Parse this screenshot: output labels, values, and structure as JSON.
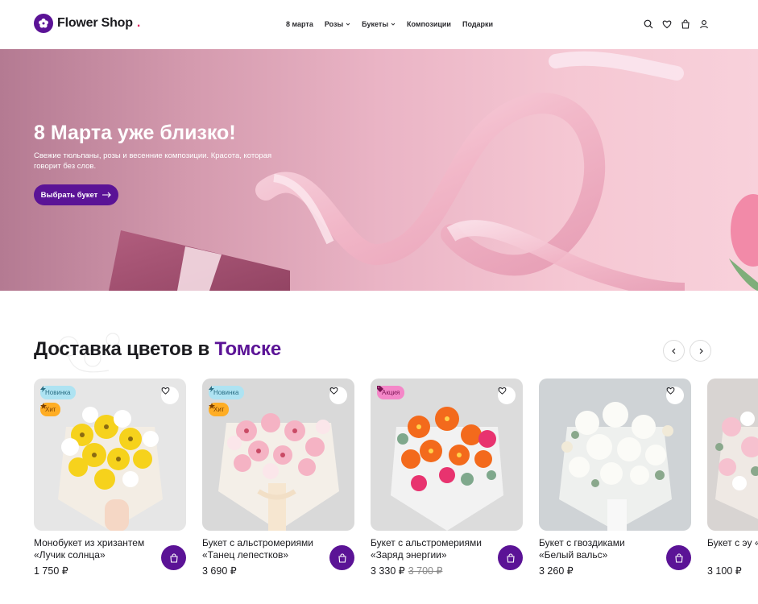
{
  "header": {
    "logo_text": "Flower Shop",
    "logo_dot": ".",
    "nav": [
      {
        "label": "8 марта",
        "dropdown": false
      },
      {
        "label": "Розы",
        "dropdown": true
      },
      {
        "label": "Букеты",
        "dropdown": true
      },
      {
        "label": "Композиции",
        "dropdown": false
      },
      {
        "label": "Подарки",
        "dropdown": false
      }
    ],
    "icons": [
      "search-icon",
      "heart-icon",
      "cart-icon",
      "user-icon"
    ]
  },
  "hero": {
    "title": "8 Марта уже близко!",
    "text": "Свежие тюльпаны, розы и весенние композиции. Красота, которая говорит без слов.",
    "button_label": "Выбрать букет",
    "button_icon": "arrow-right-icon"
  },
  "section": {
    "title_prefix": "Доставка цветов в ",
    "title_city": "Томске"
  },
  "products": [
    {
      "name": "Монобукет из хризантем «Лучик солнца»",
      "price": "1 750 ₽",
      "old_price": "",
      "badges": [
        "Новинка",
        "Хит"
      ]
    },
    {
      "name": "Букет с альстромериями «Танец лепестков»",
      "price": "3 690 ₽",
      "old_price": "",
      "badges": [
        "Новинка",
        "Хит"
      ]
    },
    {
      "name": "Букет с альстромериями «Заряд энергии»",
      "price": "3 330 ₽",
      "old_price": "3 700 ₽",
      "badges": [
        "Акция"
      ]
    },
    {
      "name": "Букет с гвоздиками «Белый вальс»",
      "price": "3 260 ₽",
      "old_price": "",
      "badges": []
    },
    {
      "name": "Букет с эу «Мягкое пр",
      "price": "3 100 ₽",
      "old_price": "",
      "badges": []
    }
  ],
  "colors": {
    "brand": "#5b1396",
    "badge_new": "#aee3f2",
    "badge_hit": "#ffad24",
    "badge_sale": "#f487c8",
    "hero_bg": "#eab4c5"
  }
}
